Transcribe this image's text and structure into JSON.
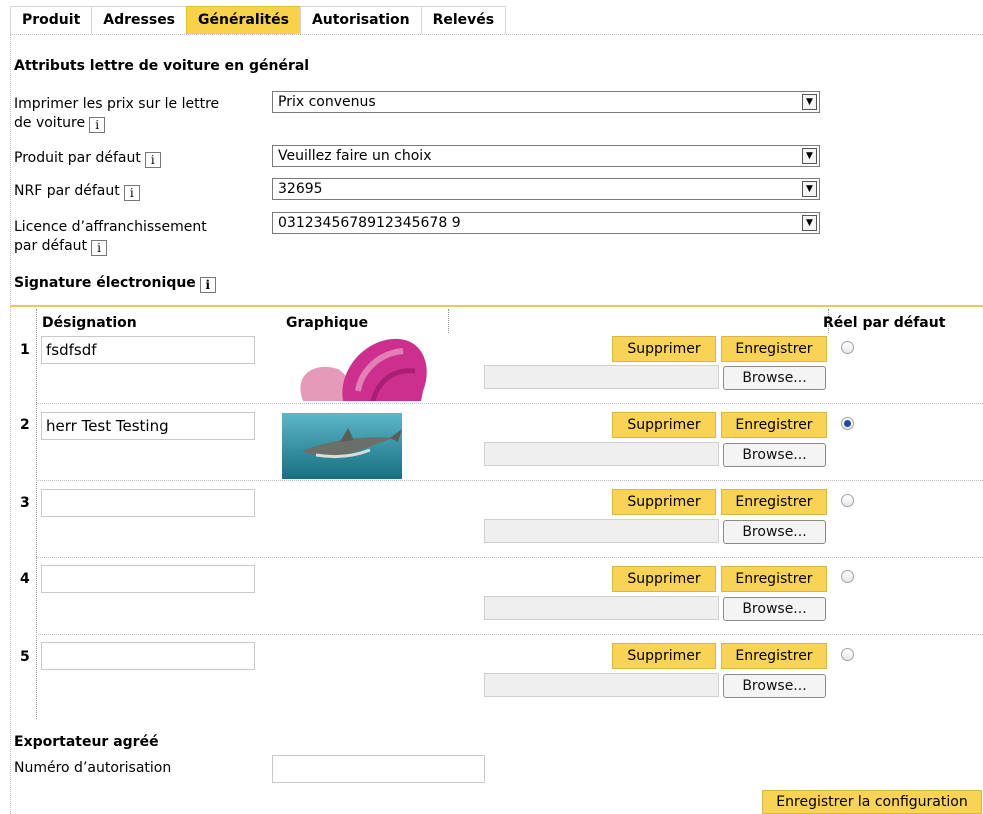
{
  "tabs": [
    "Produit",
    "Adresses",
    "Généralités",
    "Autorisation",
    "Relevés"
  ],
  "waybill": {
    "title": "Attributs lettre de voiture en général",
    "print_prices": {
      "label_line1": "Imprimer les prix sur le lettre",
      "label_line2": "de voiture",
      "value": "Prix convenus"
    },
    "default_product": {
      "label": "Produit par défaut",
      "value": "Veuillez faire un choix"
    },
    "default_nrf": {
      "label": "NRF par défaut",
      "value": "32695"
    },
    "default_license": {
      "label_line1": "Licence d’affranchissement",
      "label_line2": "par défaut",
      "value": "0312345678912345678 9"
    }
  },
  "signature": {
    "title": "Signature électronique",
    "headers": {
      "designation": "Désignation",
      "graphic": "Graphique",
      "default": "Réel par défaut"
    },
    "rows": [
      {
        "num": "1",
        "designation": "fsdfsdf",
        "delete": "Supprimer",
        "save": "Enregistrer",
        "browse": "Browse...",
        "default": false
      },
      {
        "num": "2",
        "designation": "herr Test Testing",
        "delete": "Supprimer",
        "save": "Enregistrer",
        "browse": "Browse...",
        "default": true
      },
      {
        "num": "3",
        "designation": "",
        "delete": "Supprimer",
        "save": "Enregistrer",
        "browse": "Browse...",
        "default": false
      },
      {
        "num": "4",
        "designation": "",
        "delete": "Supprimer",
        "save": "Enregistrer",
        "browse": "Browse...",
        "default": false
      },
      {
        "num": "5",
        "designation": "",
        "delete": "Supprimer",
        "save": "Enregistrer",
        "browse": "Browse...",
        "default": false
      }
    ]
  },
  "exporter": {
    "title": "Exportateur agréé",
    "auth_label": "Numéro d’autorisation",
    "auth_value": ""
  },
  "save_config_label": "Enregistrer la configuration",
  "colors": {
    "accent": "#f8d356"
  },
  "icons": {
    "info": "i",
    "dropdown": "▼"
  }
}
